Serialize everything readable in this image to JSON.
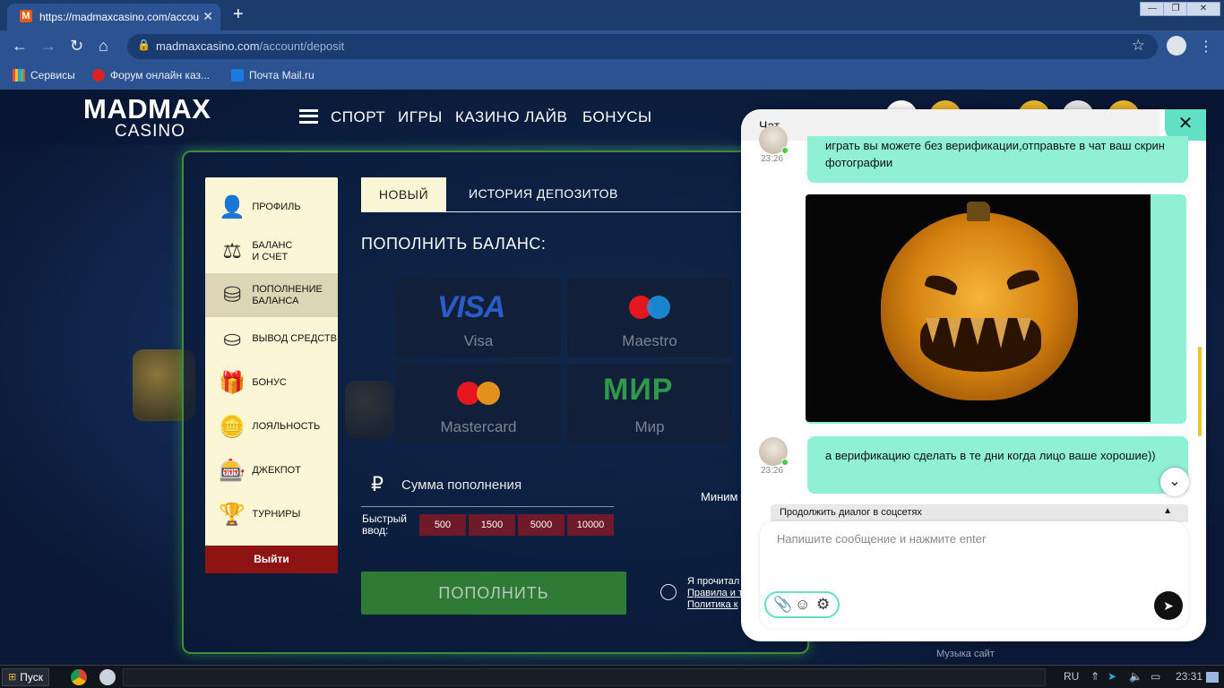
{
  "browser": {
    "tab_title": "https://madmaxcasino.com/accou",
    "tab_favicon": "M",
    "url_domain": "madmaxcasino.com",
    "url_path": "/account/deposit",
    "bookmarks": [
      "Сервисы",
      "Форум онлайн каз...",
      "Почта Mail.ru"
    ]
  },
  "site": {
    "logo_line1": "MADMAX",
    "logo_line2": "CASINO",
    "nav": [
      "СПОРТ",
      "ИГРЫ",
      "КАЗИНО ЛАЙВ",
      "БОНУСЫ"
    ],
    "sidebar": [
      {
        "label": "ПРОФИЛЬ",
        "icon": "person-icon"
      },
      {
        "label": "БАЛАНС\nИ СЧЕТ",
        "icon": "scales-icon"
      },
      {
        "label": "ПОПОЛНЕНИЕ\nБАЛАНСА",
        "icon": "coins-up-icon"
      },
      {
        "label": "ВЫВОД СРЕДСТВ",
        "icon": "coins-down-icon"
      },
      {
        "label": "БОНУС",
        "icon": "gift-icon"
      },
      {
        "label": "ЛОЯЛЬНОСТЬ",
        "icon": "coin-hand-icon"
      },
      {
        "label": "ДЖЕКПОТ",
        "icon": "slot-icon"
      },
      {
        "label": "ТУРНИРЫ",
        "icon": "trophy-icon"
      }
    ],
    "logout": "Выйти",
    "tabs": {
      "new": "НОВЫЙ",
      "history": "ИСТОРИЯ ДЕПОЗИТОВ"
    },
    "deposit_title": "ПОПОЛНИТЬ БАЛАНС:",
    "payment_methods": [
      {
        "name": "Visa",
        "logo_text": "VISA"
      },
      {
        "name": "Maestro"
      },
      {
        "name": "Mastercard"
      },
      {
        "name": "Мир",
        "logo_text": "МИР"
      }
    ],
    "currency_symbol": "₽",
    "amount_placeholder": "Сумма пополнения",
    "fast_input_label": "Быстрый\nввод:",
    "fast_amounts": [
      "500",
      "1500",
      "5000",
      "10000"
    ],
    "min_label": "Миним",
    "submit": "ПОПОЛНИТЬ",
    "terms": {
      "line1": "Я прочитал",
      "line2": "Правила и т",
      "line3": "Политика к"
    },
    "music": "Музыка сайт"
  },
  "chat": {
    "title": "Чат",
    "close": "✕",
    "messages": [
      {
        "time": "23:26",
        "text": "играть вы можете без верификации,отправьте в чат ваш скрин фотографии"
      },
      {
        "time": "23:26",
        "text": "а верификацию сделать в те дни когда лицо ваше хорошие))"
      }
    ],
    "social_bar": "Продолжить диалог в соцсетях",
    "input_placeholder": "Напишите сообщение и нажмите enter"
  },
  "taskbar": {
    "start": "Пуск",
    "lang": "RU",
    "clock": "23:31"
  }
}
